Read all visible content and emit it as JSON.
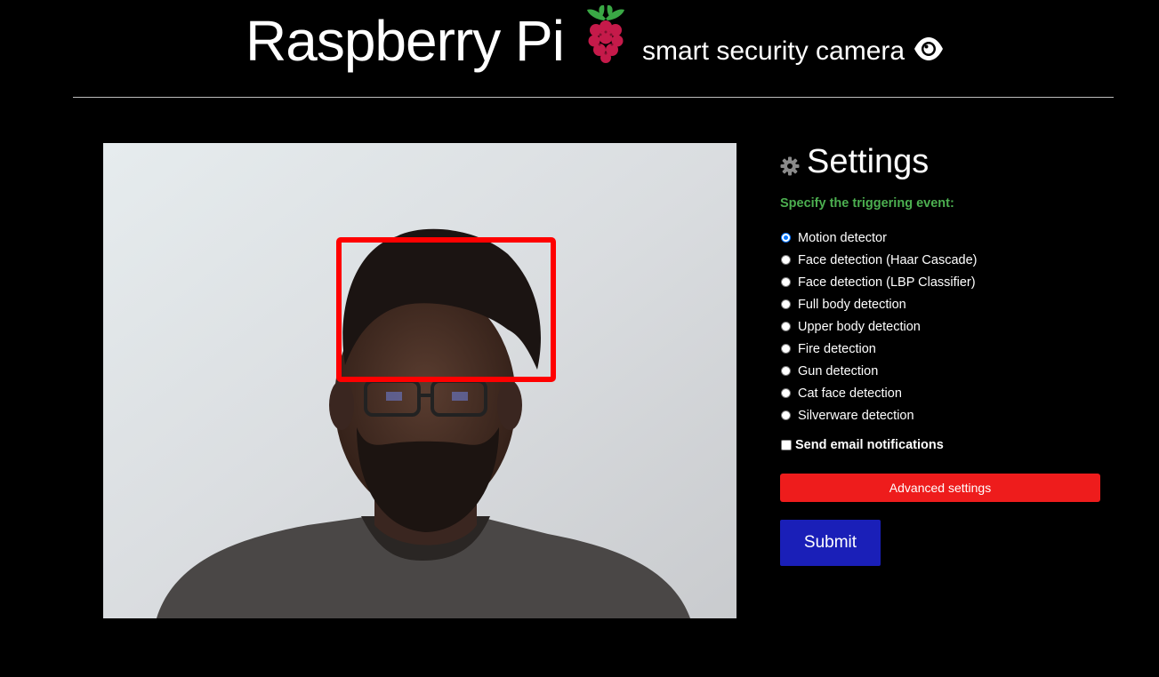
{
  "header": {
    "title": "Raspberry Pi",
    "subtitle": "smart security camera",
    "logo_icon": "raspberry-pi-logo",
    "subtitle_icon": "eye-icon"
  },
  "video": {
    "icon": "camera-feed",
    "detection_box_color": "#ff0000"
  },
  "settings": {
    "title": "Settings",
    "title_icon": "gear-icon",
    "trigger_label": "Specify the triggering event:",
    "options": [
      {
        "label": "Motion detector",
        "checked": true
      },
      {
        "label": "Face detection (Haar Cascade)",
        "checked": false
      },
      {
        "label": "Face detection (LBP Classifier)",
        "checked": false
      },
      {
        "label": "Full body detection",
        "checked": false
      },
      {
        "label": "Upper body detection",
        "checked": false
      },
      {
        "label": "Fire detection",
        "checked": false
      },
      {
        "label": "Gun detection",
        "checked": false
      },
      {
        "label": "Cat face detection",
        "checked": false
      },
      {
        "label": "Silverware detection",
        "checked": false
      }
    ],
    "email_label": "Send email notifications",
    "email_checked": false,
    "advanced_label": "Advanced settings",
    "submit_label": "Submit"
  },
  "colors": {
    "background": "#000000",
    "accent_green": "#4caf50",
    "advanced_red": "#ee1c1c",
    "submit_blue": "#1a1fb8"
  }
}
